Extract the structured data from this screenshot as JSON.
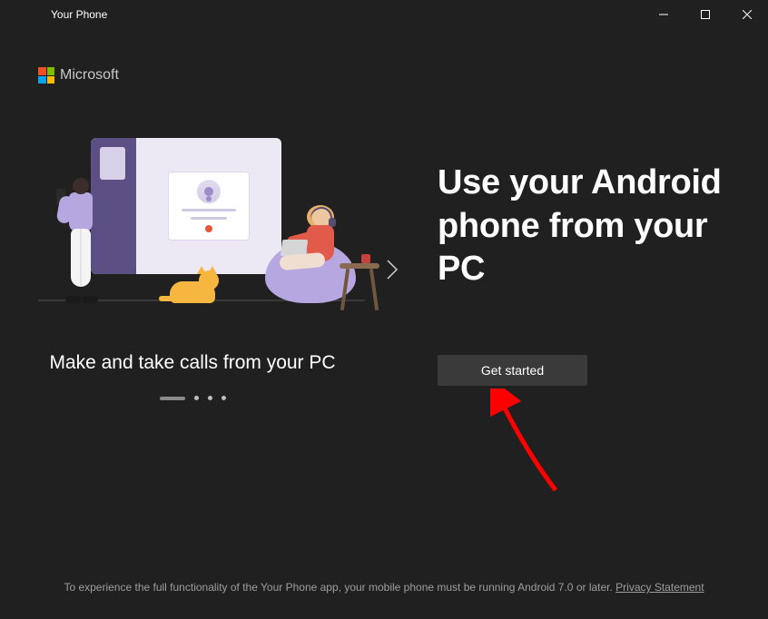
{
  "window": {
    "title": "Your Phone"
  },
  "brand": {
    "name": "Microsoft"
  },
  "carousel": {
    "caption": "Make and take calls from your PC",
    "active_index": 0,
    "total": 4
  },
  "headline": "Use your Android phone from your PC",
  "cta": {
    "label": "Get started"
  },
  "footer": {
    "text": "To experience the full functionality of the Your Phone app, your mobile phone must be running Android 7.0 or later. ",
    "link_label": "Privacy Statement"
  },
  "icons": {
    "minimize": "minimize",
    "maximize": "maximize",
    "close": "close",
    "chevron_right": "chevron-right"
  },
  "annotation": {
    "arrow_color": "#ff0000"
  }
}
